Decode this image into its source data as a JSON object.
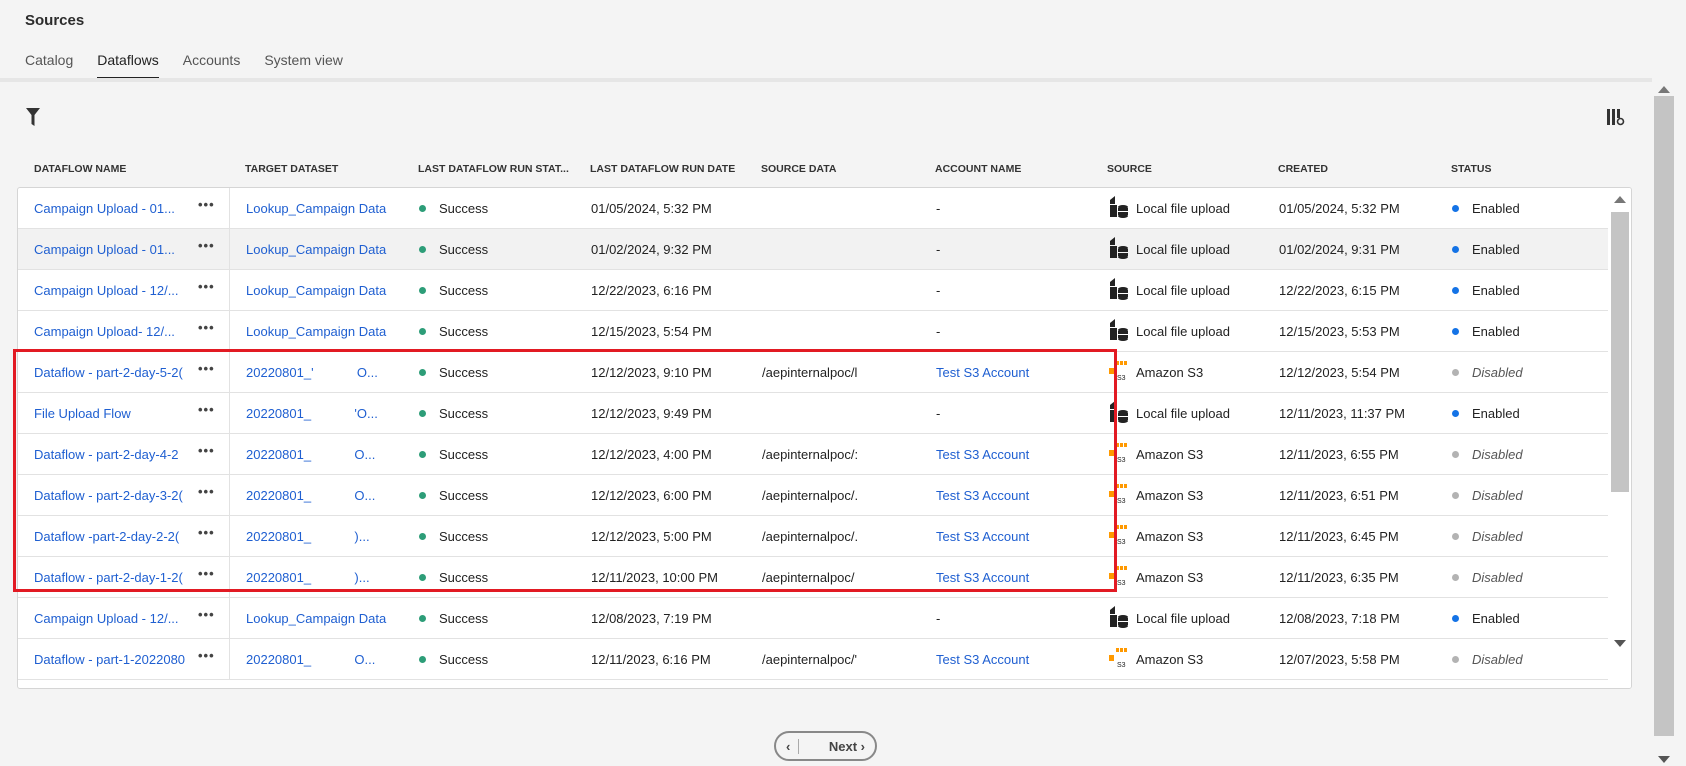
{
  "title": "Sources",
  "tabs": [
    "Catalog",
    "Dataflows",
    "Accounts",
    "System view"
  ],
  "columns": [
    "DATAFLOW NAME",
    "TARGET DATASET",
    "LAST DATAFLOW RUN STAT...",
    "LAST DATAFLOW RUN DATE",
    "SOURCE DATA",
    "ACCOUNT NAME",
    "SOURCE",
    "CREATED",
    "STATUS"
  ],
  "rows": [
    {
      "name": "Campaign Upload - 01...",
      "dataset": "Lookup_Campaign Data",
      "run_status": "Success",
      "run_date": "01/05/2024, 5:32 PM",
      "source_data": "",
      "account": "-",
      "source": "Local file upload",
      "created": "01/05/2024, 5:32 PM",
      "status": "Enabled"
    },
    {
      "name": "Campaign Upload - 01...",
      "dataset": "Lookup_Campaign Data",
      "run_status": "Success",
      "run_date": "01/02/2024, 9:32 PM",
      "source_data": "",
      "account": "-",
      "source": "Local file upload",
      "created": "01/02/2024, 9:31 PM",
      "status": "Enabled"
    },
    {
      "name": "Campaign Upload - 12/...",
      "dataset": "Lookup_Campaign Data",
      "run_status": "Success",
      "run_date": "12/22/2023, 6:16 PM",
      "source_data": "",
      "account": "-",
      "source": "Local file upload",
      "created": "12/22/2023, 6:15 PM",
      "status": "Enabled"
    },
    {
      "name": "Campaign Upload- 12/...",
      "dataset": "Lookup_Campaign Data",
      "run_status": "Success",
      "run_date": "12/15/2023, 5:54 PM",
      "source_data": "",
      "account": "-",
      "source": "Local file upload",
      "created": "12/15/2023, 5:53 PM",
      "status": "Enabled"
    },
    {
      "name": "Dataflow - part-2-day-5-2(",
      "dataset": "20220801_'            O...",
      "run_status": "Success",
      "run_date": "12/12/2023, 9:10 PM",
      "source_data": "/aepinternalpoc/l",
      "account": "Test S3 Account",
      "source": "Amazon S3",
      "created": "12/12/2023, 5:54 PM",
      "status": "Disabled"
    },
    {
      "name": "File Upload Flow",
      "dataset": "20220801_            'O...",
      "run_status": "Success",
      "run_date": "12/12/2023, 9:49 PM",
      "source_data": "",
      "account": "-",
      "source": "Local file upload",
      "created": "12/11/2023, 11:37 PM",
      "status": "Enabled"
    },
    {
      "name": "Dataflow - part-2-day-4-2",
      "dataset": "20220801_            O...",
      "run_status": "Success",
      "run_date": "12/12/2023, 4:00 PM",
      "source_data": "/aepinternalpoc/:",
      "account": "Test S3 Account",
      "source": "Amazon S3",
      "created": "12/11/2023, 6:55 PM",
      "status": "Disabled"
    },
    {
      "name": "Dataflow - part-2-day-3-2(",
      "dataset": "20220801_            O...",
      "run_status": "Success",
      "run_date": "12/12/2023, 6:00 PM",
      "source_data": "/aepinternalpoc/.",
      "account": "Test S3 Account",
      "source": "Amazon S3",
      "created": "12/11/2023, 6:51 PM",
      "status": "Disabled"
    },
    {
      "name": "Dataflow -part-2-day-2-2(",
      "dataset": "20220801_            )...",
      "run_status": "Success",
      "run_date": "12/12/2023, 5:00 PM",
      "source_data": "/aepinternalpoc/.",
      "account": "Test S3 Account",
      "source": "Amazon S3",
      "created": "12/11/2023, 6:45 PM",
      "status": "Disabled"
    },
    {
      "name": "Dataflow - part-2-day-1-2(",
      "dataset": "20220801_            )...",
      "run_status": "Success",
      "run_date": "12/11/2023, 10:00 PM",
      "source_data": "/aepinternalpoc/",
      "account": "Test S3 Account",
      "source": "Amazon S3",
      "created": "12/11/2023, 6:35 PM",
      "status": "Disabled"
    },
    {
      "name": "Campaign Upload - 12/...",
      "dataset": "Lookup_Campaign Data",
      "run_status": "Success",
      "run_date": "12/08/2023, 7:19 PM",
      "source_data": "",
      "account": "-",
      "source": "Local file upload",
      "created": "12/08/2023, 7:18 PM",
      "status": "Enabled"
    },
    {
      "name": "Dataflow - part-1-2022080",
      "dataset": "20220801_            O...",
      "run_status": "Success",
      "run_date": "12/11/2023, 6:16 PM",
      "source_data": "/aepinternalpoc/'",
      "account": "Test S3 Account",
      "source": "Amazon S3",
      "created": "12/07/2023, 5:58 PM",
      "status": "Disabled"
    }
  ],
  "pager": {
    "next": "Next"
  },
  "colors": {
    "success": "#2d9d78",
    "enabled": "#1473e6",
    "disabled": "#b3b3b3",
    "link": "#1f5fd1",
    "highlight": "#e21a23"
  }
}
